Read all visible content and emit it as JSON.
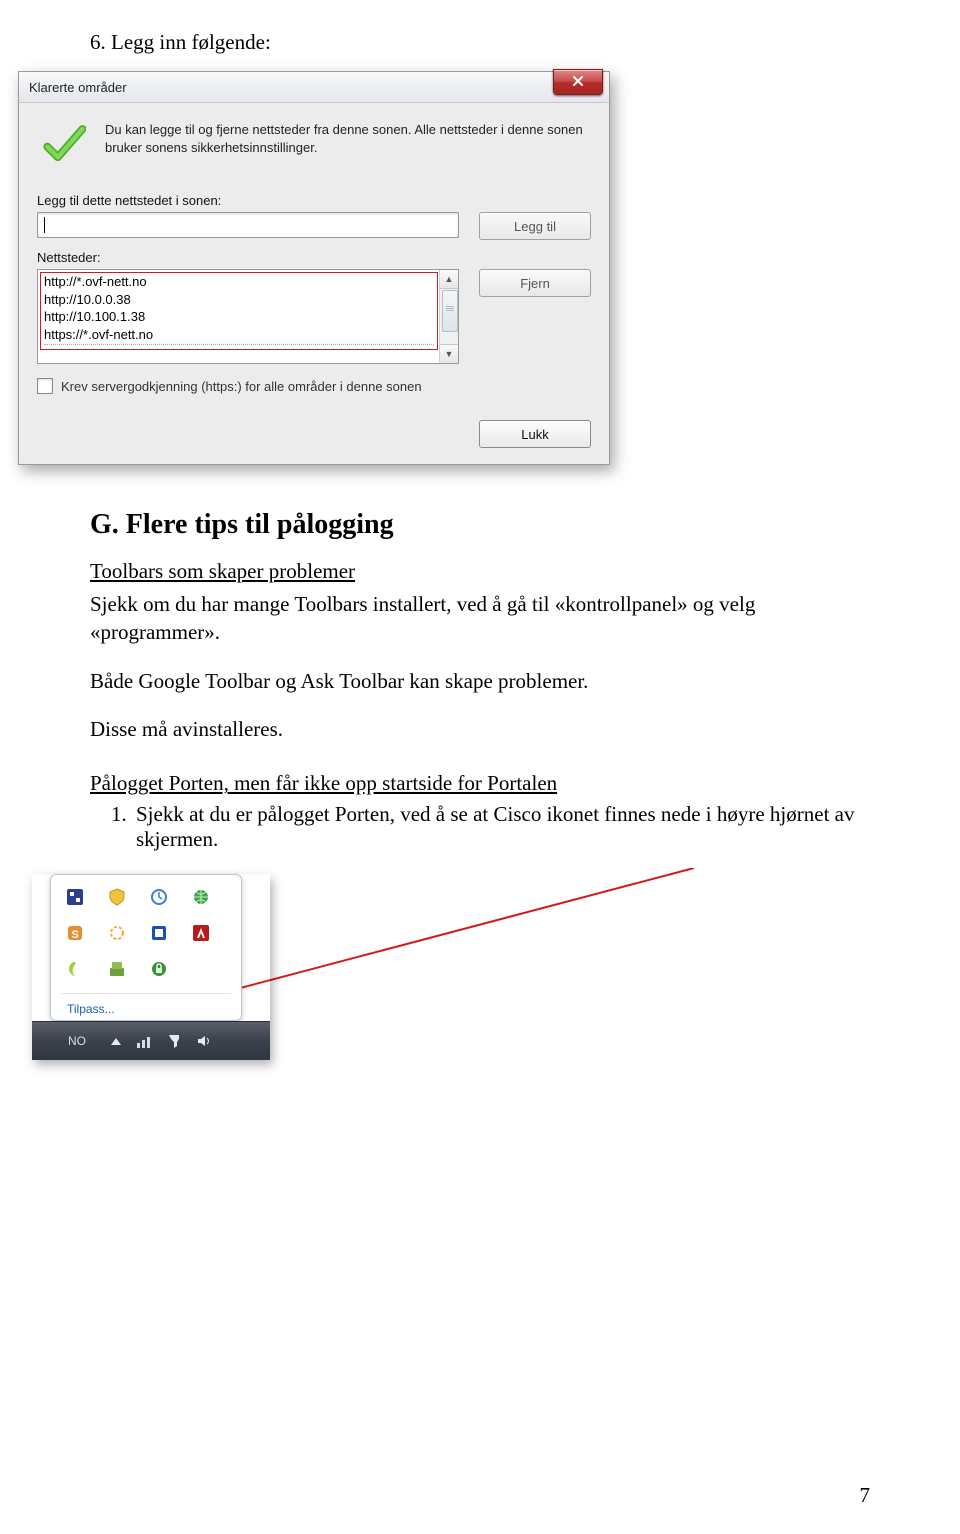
{
  "step6": "6.  Legg inn følgende:",
  "dialog": {
    "title": "Klarerte områder",
    "info": "Du kan legge til og fjerne nettsteder fra denne sonen. Alle nettsteder i denne sonen bruker sonens sikkerhetsinnstillinger.",
    "addLabel": "Legg til dette nettstedet i sonen:",
    "addBtn": "Legg til",
    "listLabel": "Nettsteder:",
    "removeBtn": "Fjern",
    "sites": [
      "http://*.ovf-nett.no",
      "http://10.0.0.38",
      "http://10.100.1.38",
      "https://*.ovf-nett.no"
    ],
    "checkbox": "Krev servergodkjenning (https:) for alle områder i denne sonen",
    "closeBtn": "Lukk"
  },
  "sectionG": {
    "heading": "G.  Flere tips til pålogging",
    "sub1": "Toolbars som skaper problemer",
    "p1": "Sjekk om du har mange Toolbars installert, ved å gå til «kontrollpanel» og velg «programmer».",
    "p2": "Både Google Toolbar og Ask Toolbar kan skape problemer.",
    "p3": "Disse må avinstalleres.",
    "sub2": "Pålogget Porten, men får ikke opp startside for Portalen",
    "ol1": "Sjekk at du er pålogget Porten, ved å se at Cisco ikonet finnes nede i høyre hjørnet av skjermen."
  },
  "tray": {
    "customize": "Tilpass...",
    "lang": "NO"
  },
  "pageNumber": "7"
}
